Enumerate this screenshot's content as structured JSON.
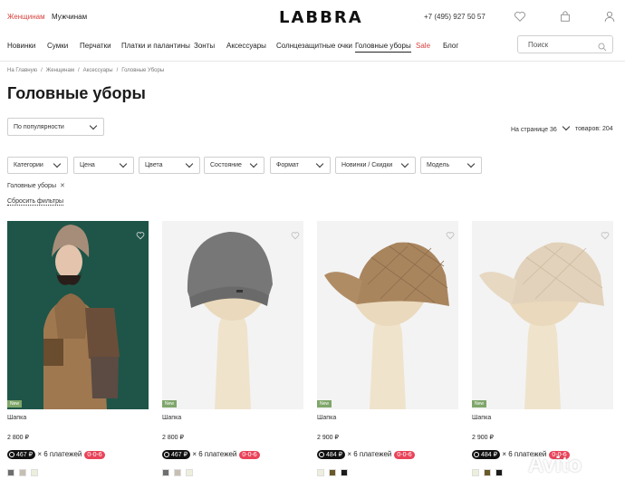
{
  "header": {
    "women": "Женщинам",
    "men": "Мужчинам",
    "logo": "LABBRA",
    "phone": "+7 (495) 927 50 57"
  },
  "nav": {
    "items": [
      "Новинки",
      "Сумки",
      "Перчатки",
      "Платки и палантины",
      "Зонты",
      "Аксессуары",
      "Солнцезащитные очки",
      "Головные уборы",
      "Sale",
      "Блог"
    ],
    "active": "Головные уборы",
    "search_placeholder": "Поиск"
  },
  "breadcrumb": [
    "На Главную",
    "Женщинам",
    "Аксессуары",
    "Головные Уборы"
  ],
  "page_title": "Головные уборы",
  "sort": {
    "label": "По популярности"
  },
  "pagination": {
    "per_page_label": "На странице",
    "per_page_value": "36",
    "goods_count": "товаров: 204"
  },
  "filters": [
    "Категории",
    "Цена",
    "Цвета",
    "Состояние",
    "Формат",
    "Новинки / Скидки",
    "Модель"
  ],
  "active_filter": "Головные уборы",
  "reset_label": "Сбросить фильтры",
  "products": [
    {
      "name": "Шапка",
      "price": "2 800 ₽",
      "badge": "New",
      "installment": "467 ₽",
      "installment_text": "× 6 платежей",
      "plan": "0-0-6",
      "swatches": [
        "#6e6e6e",
        "#c7bfb2",
        "#eeeedd"
      ]
    },
    {
      "name": "Шапка",
      "price": "2 800 ₽",
      "badge": "New",
      "installment": "467 ₽",
      "installment_text": "× 6 платежей",
      "plan": "0-0-6",
      "swatches": [
        "#6e6e6e",
        "#c7bfb2",
        "#eeeedd"
      ]
    },
    {
      "name": "Шапка",
      "price": "2 900 ₽",
      "badge": "New",
      "installment": "484 ₽",
      "installment_text": "× 6 платежей",
      "plan": "0-0-6",
      "swatches": [
        "#eeeedd",
        "#6a5a2a",
        "#1b1b1b"
      ]
    },
    {
      "name": "Шапка",
      "price": "2 900 ₽",
      "badge": "New",
      "installment": "484 ₽",
      "installment_text": "× 6 платежей",
      "plan": "0-0-6",
      "swatches": [
        "#eeeedd",
        "#6a5a2a",
        "#1b1b1b"
      ]
    }
  ],
  "watermark": "Avito",
  "colors": {
    "accent": "#d6433f",
    "badge": "#7fa66a",
    "plan": "#e9445a"
  }
}
